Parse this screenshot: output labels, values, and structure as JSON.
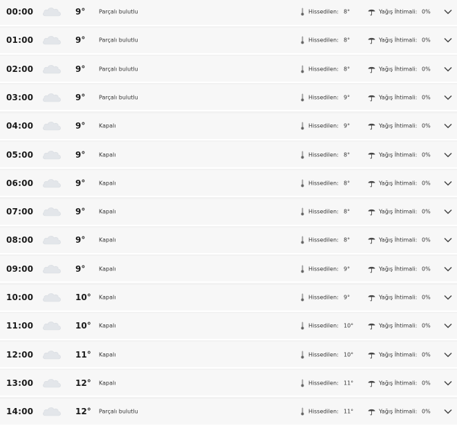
{
  "forecast": {
    "feels_label": "Hissedilen:",
    "rain_label": "Yağış İhtimali:",
    "rows": [
      {
        "time": "00:00",
        "temp": "9°",
        "desc": "Parçalı bulutlu",
        "feels": "8°",
        "rain": "0%"
      },
      {
        "time": "01:00",
        "temp": "9°",
        "desc": "Parçalı bulutlu",
        "feels": "8°",
        "rain": "0%"
      },
      {
        "time": "02:00",
        "temp": "9°",
        "desc": "Parçalı bulutlu",
        "feels": "8°",
        "rain": "0%"
      },
      {
        "time": "03:00",
        "temp": "9°",
        "desc": "Parçalı bulutlu",
        "feels": "9°",
        "rain": "0%"
      },
      {
        "time": "04:00",
        "temp": "9°",
        "desc": "Kapalı",
        "feels": "9°",
        "rain": "0%"
      },
      {
        "time": "05:00",
        "temp": "9°",
        "desc": "Kapalı",
        "feels": "8°",
        "rain": "0%"
      },
      {
        "time": "06:00",
        "temp": "9°",
        "desc": "Kapalı",
        "feels": "8°",
        "rain": "0%"
      },
      {
        "time": "07:00",
        "temp": "9°",
        "desc": "Kapalı",
        "feels": "8°",
        "rain": "0%"
      },
      {
        "time": "08:00",
        "temp": "9°",
        "desc": "Kapalı",
        "feels": "8°",
        "rain": "0%"
      },
      {
        "time": "09:00",
        "temp": "9°",
        "desc": "Kapalı",
        "feels": "9°",
        "rain": "0%"
      },
      {
        "time": "10:00",
        "temp": "10°",
        "desc": "Kapalı",
        "feels": "9°",
        "rain": "0%"
      },
      {
        "time": "11:00",
        "temp": "10°",
        "desc": "Kapalı",
        "feels": "10°",
        "rain": "0%"
      },
      {
        "time": "12:00",
        "temp": "11°",
        "desc": "Kapalı",
        "feels": "10°",
        "rain": "0%"
      },
      {
        "time": "13:00",
        "temp": "12°",
        "desc": "Kapalı",
        "feels": "11°",
        "rain": "0%"
      },
      {
        "time": "14:00",
        "temp": "12°",
        "desc": "Parçalı bulutlu",
        "feels": "11°",
        "rain": "0%"
      }
    ]
  },
  "icons": {
    "weather": "cloud-icon",
    "feels": "thermometer-icon",
    "rain": "umbrella-icon",
    "expand": "chevron-down-icon"
  }
}
